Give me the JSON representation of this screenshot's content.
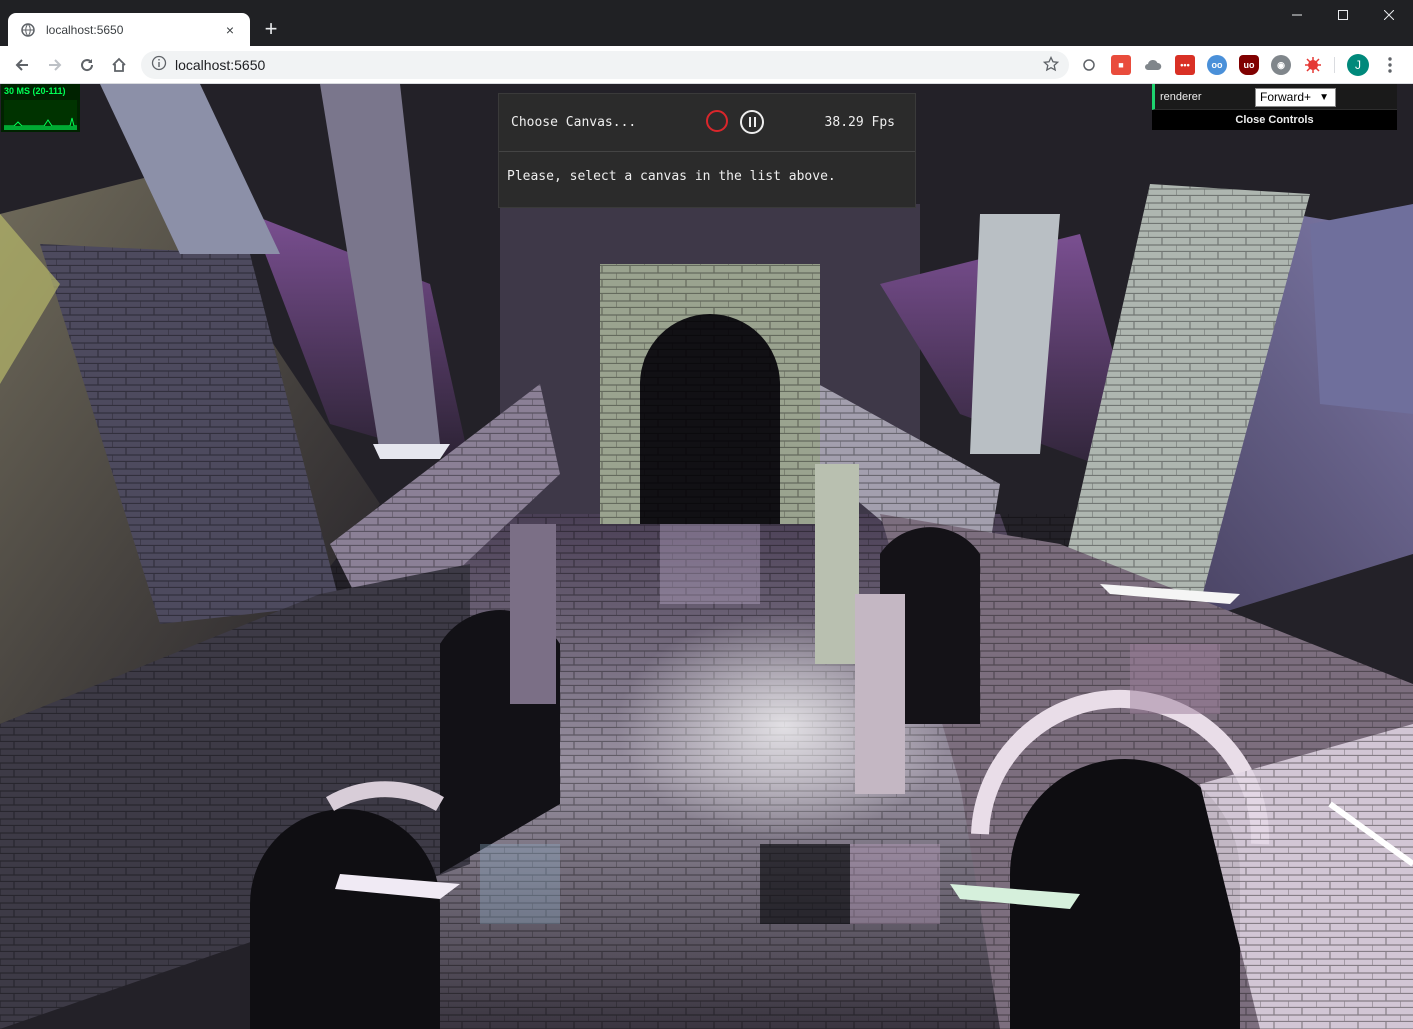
{
  "browser": {
    "tab_title": "localhost:5650",
    "tab_close": "×",
    "new_tab": "+",
    "url": "localhost:5650",
    "profile_initial": "J"
  },
  "stats": {
    "label": "30 MS (20-111)"
  },
  "inspector": {
    "choose_label": "Choose Canvas...",
    "fps": "38.29 Fps",
    "message": "Please, select a canvas in the list above."
  },
  "gui": {
    "renderer_label": "renderer",
    "renderer_value": "Forward+",
    "close_label": "Close Controls"
  },
  "colors": {
    "record": "#d9262b",
    "gui_accent": "#1ed36f",
    "stats_text": "#00ff55"
  }
}
